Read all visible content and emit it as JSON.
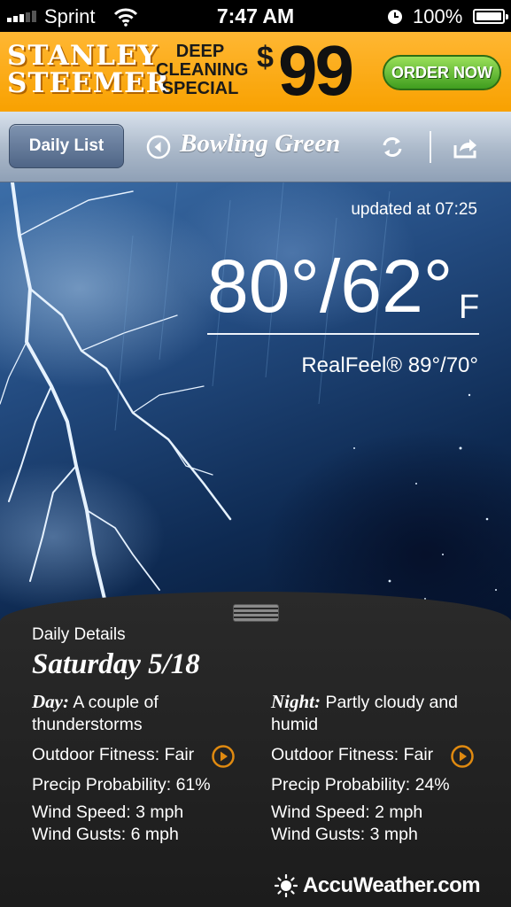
{
  "status_bar": {
    "carrier": "Sprint",
    "time": "7:47 AM",
    "battery": "100%"
  },
  "ad": {
    "brand_line1": "STANLEY",
    "brand_line2": "STEEMER",
    "promo_line1": "DEEP",
    "promo_line2": "CLEANING",
    "promo_line3": "SPECIAL",
    "price_sign": "$",
    "price": "99",
    "cta": "ORDER NOW"
  },
  "navbar": {
    "daily_list_label": "Daily List",
    "city": "Bowling Green"
  },
  "current": {
    "updated": "updated at 07:25",
    "temps": "80°/62°",
    "unit": "F",
    "realfeel": "RealFeel® 89°/70°"
  },
  "details": {
    "section_label": "Daily Details",
    "date": "Saturday 5/18",
    "day": {
      "label": "Day:",
      "summary": "A couple of thunderstorms",
      "fitness": "Outdoor Fitness: Fair",
      "precip": "Precip Probability: 61%",
      "wind_speed": "Wind Speed: 3 mph",
      "wind_gusts": "Wind Gusts: 6 mph"
    },
    "night": {
      "label": "Night:",
      "summary": "Partly cloudy and humid",
      "fitness": "Outdoor Fitness: Fair",
      "precip": "Precip Probability: 24%",
      "wind_speed": "Wind Speed: 2 mph",
      "wind_gusts": "Wind Gusts: 3 mph"
    }
  },
  "footer": {
    "logo_text": "AccuWeather.com"
  },
  "colors": {
    "ad_orange": "#f8a100",
    "cta_green": "#4aa826",
    "nav_blue": "#aab8c9",
    "play_orange": "#e08a10",
    "panel_dark": "#222222"
  },
  "icons": [
    "signal-bars-icon",
    "wifi-icon",
    "rotation-lock-icon",
    "battery-icon",
    "back-arrow-icon",
    "refresh-icon",
    "share-icon",
    "play-icon",
    "sun-logo-icon"
  ]
}
